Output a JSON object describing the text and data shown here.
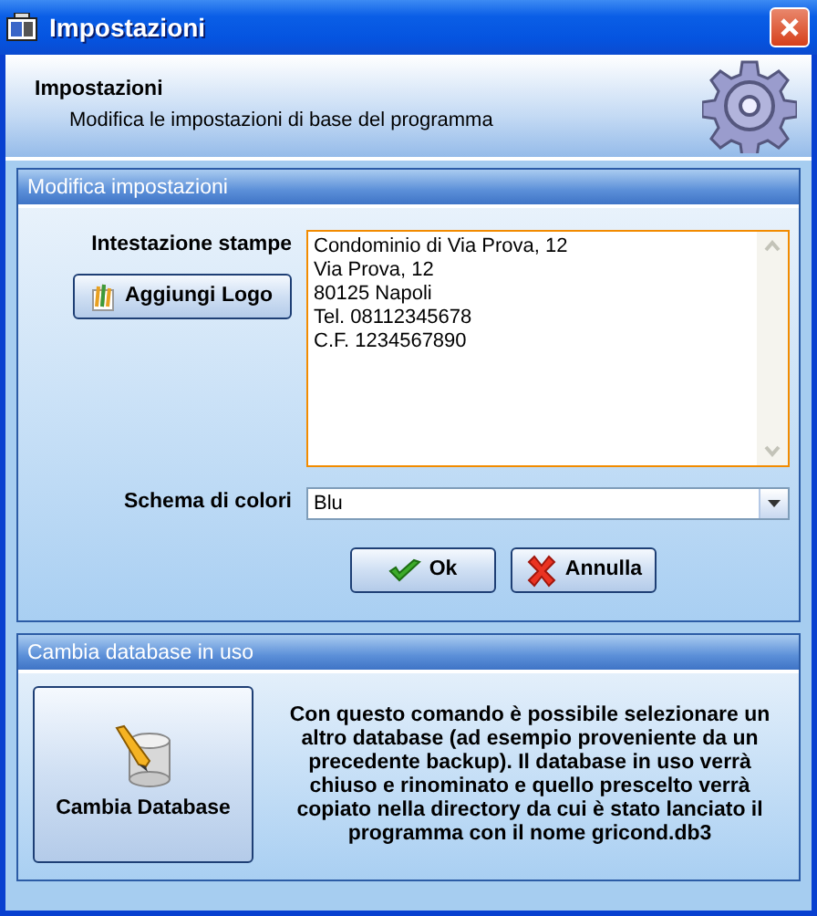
{
  "window": {
    "title": "Impostazioni"
  },
  "header": {
    "title": "Impostazioni",
    "subtitle": "Modifica le impostazioni di base del programma"
  },
  "settings_group": {
    "title": "Modifica impostazioni",
    "print_header_label": "Intestazione stampe",
    "add_logo_button": {
      "label": "Aggiungi Logo"
    },
    "print_header_lines": [
      "Condominio di Via Prova, 12",
      "Via Prova, 12",
      "80125 Napoli",
      "Tel. 08112345678",
      "C.F. 1234567890"
    ],
    "color_scheme_label": "Schema di colori",
    "color_scheme_value": "Blu",
    "buttons": [
      {
        "kind": "ok",
        "label": "Ok"
      },
      {
        "kind": "cancel",
        "label": "Annulla"
      }
    ]
  },
  "database_group": {
    "title": "Cambia database in uso",
    "button": {
      "label": "Cambia Database"
    },
    "description": "Con questo comando è possibile selezionare un altro database (ad esempio proveniente da un precedente backup). Il database in uso verrà chiuso e rinominato e quello prescelto verrà copiato nella directory da cui è stato lanciato il programma con il nome gricond.db3"
  }
}
